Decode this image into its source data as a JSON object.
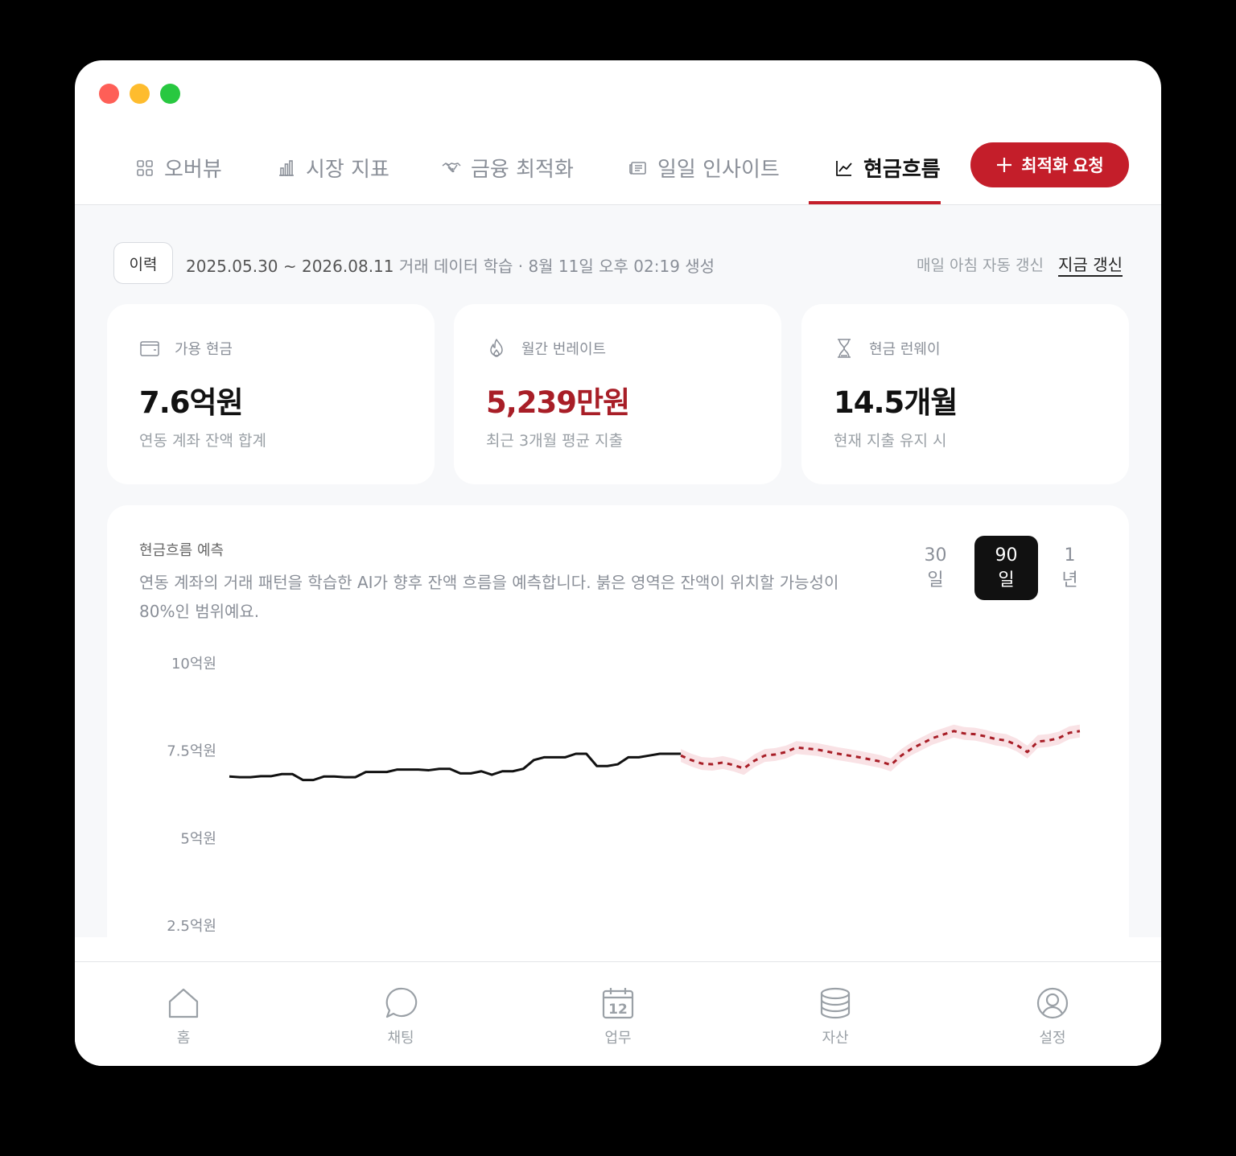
{
  "tabs": [
    {
      "label": "오버뷰",
      "icon": "grid-icon"
    },
    {
      "label": "시장 지표",
      "icon": "bar-chart-icon"
    },
    {
      "label": "금융 최적화",
      "icon": "handshake-icon"
    },
    {
      "label": "일일 인사이트",
      "icon": "newspaper-icon"
    },
    {
      "label": "현금흐름",
      "icon": "trend-line-icon",
      "active": true
    }
  ],
  "cta_label": "최적화 요청",
  "history": {
    "chip": "이력",
    "range": "2025.05.30 ~ 2026.08.11",
    "subtitle": " 거래 데이터 학습 · 8월 11일 오후 02:19 생성",
    "auto_note": "매일 아침 자동 갱신",
    "refresh": "지금 갱신"
  },
  "cards": [
    {
      "label": "가용 현금",
      "icon": "wallet-icon",
      "value": "7.6억원",
      "desc": "연동 계좌 잔액 합계"
    },
    {
      "label": "월간 번레이트",
      "icon": "flame-icon",
      "value": "5,239만원",
      "desc": "최근 3개월 평균 지출",
      "value_color": "#a81e27"
    },
    {
      "label": "현금 런웨이",
      "icon": "hourglass-icon",
      "value": "14.5개월",
      "desc": "현재 지출 유지 시"
    }
  ],
  "forecast": {
    "title": "현금흐름 예측",
    "description": "연동 계좌의 거래 패턴을 학습한 AI가 향후 잔액 흐름을 예측합니다. 붉은 영역은 잔액이 위치할 가능성이 80%인 범위예요.",
    "ranges": [
      {
        "top": "30",
        "bottom": "일"
      },
      {
        "top": "90",
        "bottom": "일",
        "active": true
      },
      {
        "top": "1",
        "bottom": "년"
      }
    ]
  },
  "chart_data": {
    "type": "line",
    "unit": "억원",
    "y_ticks": [
      "10억원",
      "7.5억원",
      "5억원",
      "2.5억원"
    ],
    "ylim": [
      2.5,
      10
    ],
    "series": [
      {
        "kind": "actual",
        "color": "#111111",
        "values": [
          6.75,
          6.73,
          6.73,
          6.76,
          6.76,
          6.82,
          6.82,
          6.65,
          6.65,
          6.75,
          6.75,
          6.73,
          6.73,
          6.88,
          6.88,
          6.88,
          6.95,
          6.95,
          6.95,
          6.93,
          6.97,
          6.97,
          6.84,
          6.84,
          6.9,
          6.8,
          6.9,
          6.9,
          6.97,
          7.22,
          7.3,
          7.3,
          7.3,
          7.4,
          7.4,
          7.05,
          7.05,
          7.1,
          7.3,
          7.3,
          7.35,
          7.4,
          7.4,
          7.4
        ]
      },
      {
        "kind": "forecast",
        "color": "#a81e27",
        "band": "80%",
        "values": [
          7.35,
          7.22,
          7.12,
          7.1,
          7.15,
          7.08,
          6.98,
          7.2,
          7.35,
          7.38,
          7.45,
          7.58,
          7.55,
          7.52,
          7.46,
          7.4,
          7.35,
          7.3,
          7.24,
          7.18,
          7.08,
          7.35,
          7.55,
          7.7,
          7.85,
          7.95,
          8.05,
          7.98,
          7.96,
          7.9,
          7.82,
          7.78,
          7.65,
          7.45,
          7.75,
          7.78,
          7.85,
          8.0,
          8.05
        ]
      }
    ]
  },
  "nav": [
    {
      "label": "홈",
      "icon": "home-icon"
    },
    {
      "label": "채팅",
      "icon": "chat-icon"
    },
    {
      "label": "업무",
      "icon": "calendar-icon",
      "badge": "12"
    },
    {
      "label": "자산",
      "icon": "coins-icon"
    },
    {
      "label": "설정",
      "icon": "user-circle-icon"
    }
  ]
}
